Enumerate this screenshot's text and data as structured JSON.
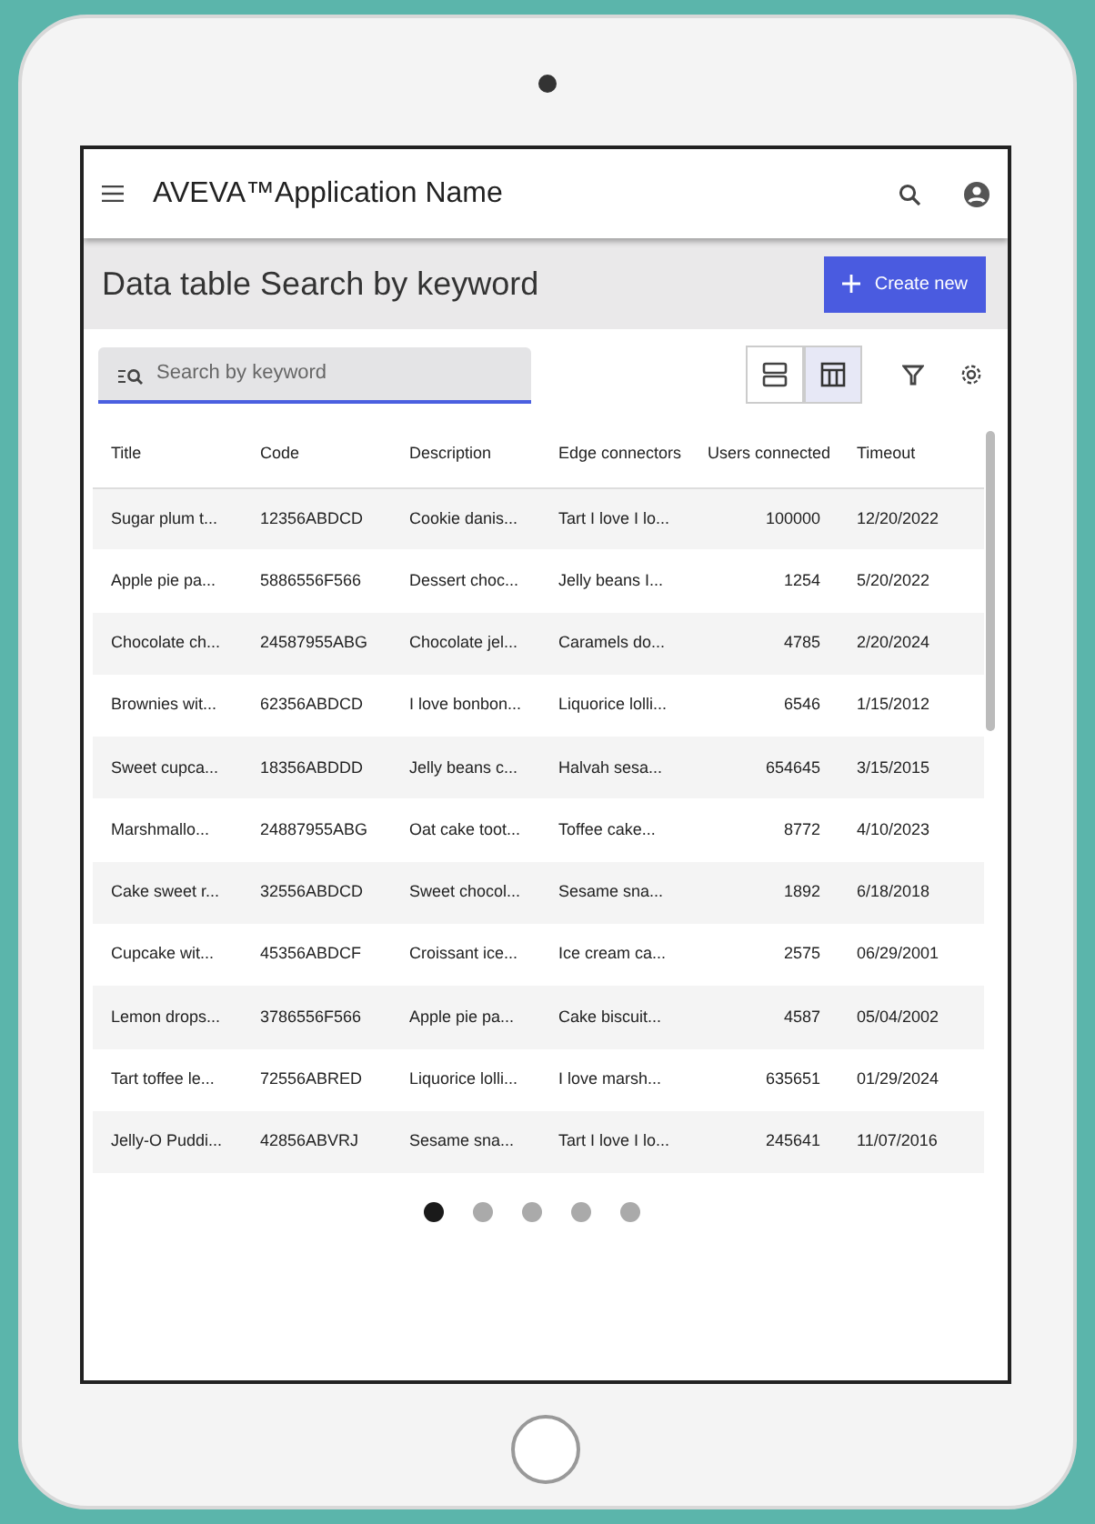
{
  "app_bar": {
    "title": "AVEVA™Application Name"
  },
  "page_header": {
    "title": "Data table Search by keyword",
    "create_button": "Create new"
  },
  "search": {
    "placeholder": "Search by keyword"
  },
  "view_toggle": [
    {
      "kind": "rows",
      "selected": false
    },
    {
      "kind": "table",
      "selected": true
    }
  ],
  "table": {
    "columns": [
      {
        "label": "Title",
        "kind": "text"
      },
      {
        "label": "Code",
        "kind": "text"
      },
      {
        "label": "Description",
        "kind": "text"
      },
      {
        "label": "Edge connectors",
        "kind": "text"
      },
      {
        "label": "Users connected",
        "kind": "number"
      },
      {
        "label": "Timeout",
        "kind": "text"
      }
    ],
    "rows": [
      [
        "Sugar plum t...",
        "12356ABDCD",
        "Cookie danis...",
        "Tart I love I lo...",
        "100000",
        "12/20/2022"
      ],
      [
        "Apple pie pa...",
        "5886556F566",
        "Dessert choc...",
        "Jelly beans I...",
        "1254",
        "5/20/2022"
      ],
      [
        "Chocolate ch...",
        "24587955ABG",
        "Chocolate jel...",
        "Caramels do...",
        "4785",
        "2/20/2024"
      ],
      [
        "Brownies wit...",
        "62356ABDCD",
        "I love bonbon...",
        "Liquorice lolli...",
        "6546",
        "1/15/2012"
      ],
      [
        "Sweet cupca...",
        "18356ABDDD",
        "Jelly beans c...",
        "Halvah sesa...",
        "654645",
        "3/15/2015"
      ],
      [
        "Marshmallo...",
        "24887955ABG",
        "Oat cake toot...",
        "Toffee cake...",
        "8772",
        "4/10/2023"
      ],
      [
        "Cake sweet r...",
        "32556ABDCD",
        "Sweet chocol...",
        "Sesame sna...",
        "1892",
        "6/18/2018"
      ],
      [
        "Cupcake wit...",
        "45356ABDCF",
        "Croissant ice...",
        "Ice cream ca...",
        "2575",
        "06/29/2001"
      ],
      [
        "Lemon drops...",
        "3786556F566",
        "Apple pie pa...",
        "Cake biscuit...",
        "4587",
        "05/04/2002"
      ],
      [
        "Tart toffee le...",
        "72556ABRED",
        "Liquorice lolli...",
        "I love marsh...",
        "635651",
        "01/29/2024"
      ],
      [
        "Jelly-O Puddi...",
        "42856ABVRJ",
        "Sesame sna...",
        "Tart I love I lo...",
        "245641",
        "11/07/2016"
      ]
    ]
  },
  "pagination": [
    {
      "selected": true
    },
    {
      "selected": false
    },
    {
      "selected": false
    },
    {
      "selected": false
    },
    {
      "selected": false
    }
  ]
}
